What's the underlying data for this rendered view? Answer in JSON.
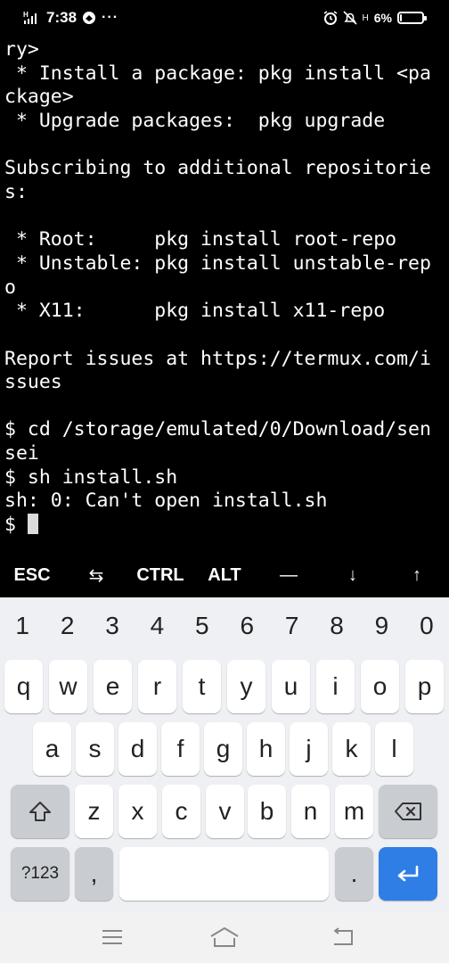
{
  "status_bar": {
    "time": "7:38",
    "signal_label": "H",
    "more_indicator": "···",
    "network_label": "H",
    "battery_percent": "6%",
    "battery_level": 0.06
  },
  "terminal": {
    "lines": [
      "ry>",
      " * Install a package: pkg install <pa",
      "ckage>",
      " * Upgrade packages:  pkg upgrade",
      "",
      "Subscribing to additional repositorie",
      "s:",
      "",
      " * Root:     pkg install root-repo",
      " * Unstable: pkg install unstable-rep",
      "o",
      " * X11:      pkg install x11-repo",
      "",
      "Report issues at https://termux.com/i",
      "ssues",
      "",
      "$ cd /storage/emulated/0/Download/sen",
      "sei",
      "$ sh install.sh",
      "sh: 0: Can't open install.sh",
      "$ "
    ]
  },
  "extra_keys": {
    "esc": "ESC",
    "tab": "⇆",
    "ctrl": "CTRL",
    "alt": "ALT",
    "dash": "—",
    "down": "↓",
    "up": "↑"
  },
  "keyboard": {
    "numbers": [
      "1",
      "2",
      "3",
      "4",
      "5",
      "6",
      "7",
      "8",
      "9",
      "0"
    ],
    "row1": [
      "q",
      "w",
      "e",
      "r",
      "t",
      "y",
      "u",
      "i",
      "o",
      "p"
    ],
    "row2": [
      "a",
      "s",
      "d",
      "f",
      "g",
      "h",
      "j",
      "k",
      "l"
    ],
    "row3": [
      "z",
      "x",
      "c",
      "v",
      "b",
      "n",
      "m"
    ],
    "symbols_label": "?123",
    "comma": ",",
    "period": ".",
    "accent_color": "#2f7ee6"
  },
  "icons": {
    "shift": "shift-icon",
    "backspace": "backspace-icon",
    "enter": "enter-icon",
    "menu": "menu-icon",
    "home": "home-icon",
    "back": "back-icon"
  }
}
